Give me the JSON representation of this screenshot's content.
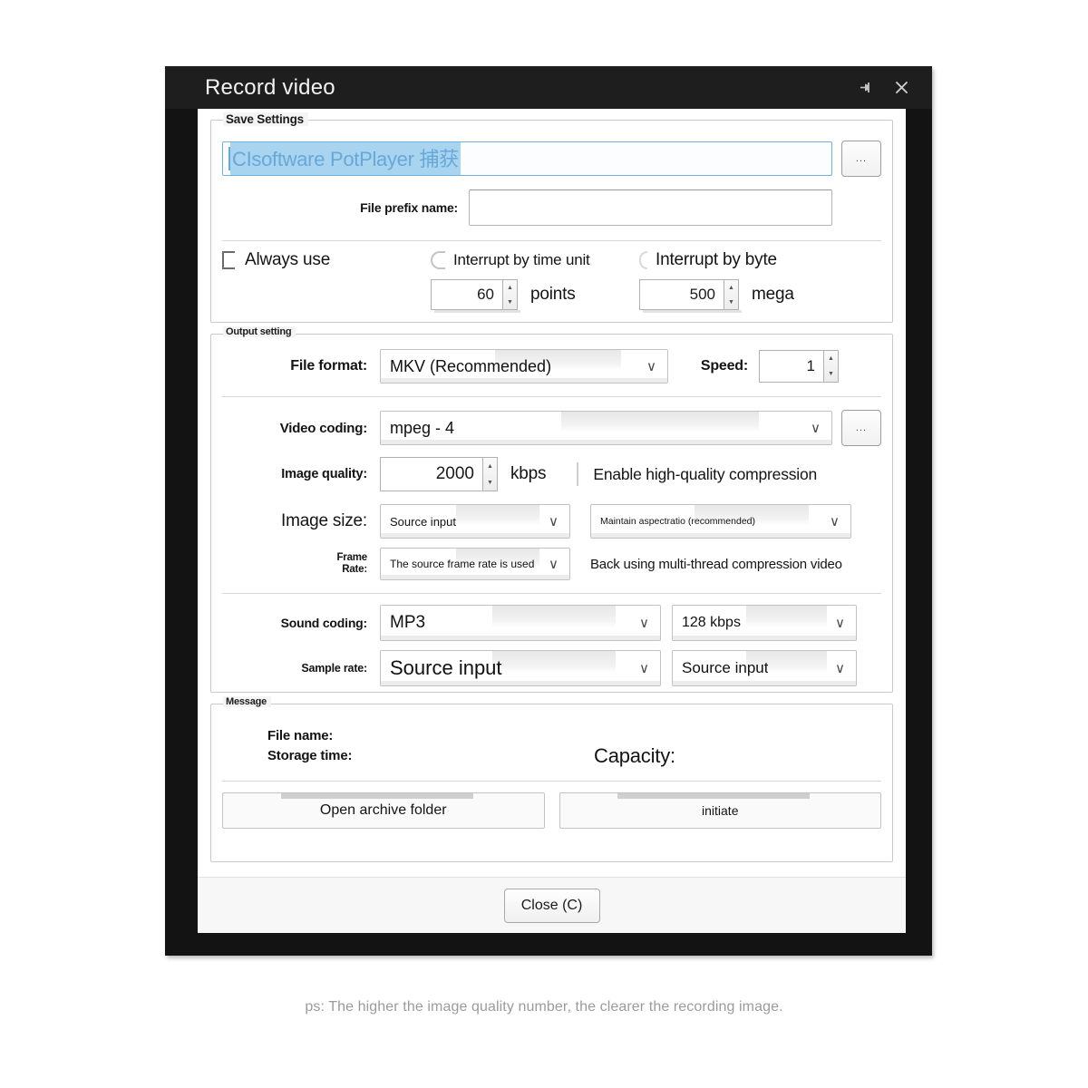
{
  "window": {
    "title": "Record video",
    "pin_icon": "pin-icon",
    "close_icon": "close-icon"
  },
  "save_settings": {
    "group_title": "Save Settings",
    "path_value": "CIsoftware PotPlayer 捕获",
    "path_browse_label": "...",
    "file_prefix_label": "File prefix name:",
    "file_prefix_value": "",
    "always_use_label": "Always use",
    "interrupt_time_label": "Interrupt by time unit",
    "interrupt_byte_label": "Interrupt by byte",
    "time_value": "60",
    "time_unit": "points",
    "byte_value": "500",
    "byte_unit": "mega"
  },
  "output_setting": {
    "group_title": "Output setting",
    "file_format_label": "File format:",
    "file_format_value": "MKV (Recommended)",
    "speed_label": "Speed:",
    "speed_value": "1",
    "video_coding_label": "Video coding:",
    "video_coding_value": "mpeg - 4",
    "video_coding_browse_label": "...",
    "image_quality_label": "Image quality:",
    "image_quality_value": "2000",
    "image_quality_unit": "kbps",
    "high_quality_label": "Enable high-quality compression",
    "image_size_label": "Image size:",
    "image_size_value": "Source input",
    "aspect_ratio_value": "Maintain aspectratio (recommended)",
    "frame_rate_label": "Frame\nRate:",
    "frame_rate_label_line1": "Frame",
    "frame_rate_label_line2": "Rate:",
    "frame_rate_value": "The source frame rate is used",
    "multithread_label": "Back using multi-thread compression video",
    "sound_coding_label": "Sound coding:",
    "sound_coding_value": "MP3",
    "sound_bitrate_value": "128 kbps",
    "sample_rate_label": "Sample rate:",
    "sample_rate_value": "Source input",
    "channel_value": "Source input"
  },
  "message": {
    "group_title": "Message",
    "file_name_label": "File name:",
    "storage_time_label": "Storage time:",
    "capacity_label": "Capacity:",
    "open_folder_label": "Open archive folder",
    "initiate_label": "initiate"
  },
  "footer": {
    "close_label": "Close (C)"
  },
  "footnote": {
    "text": "ps: The higher the image quality number, the clearer the recording image."
  },
  "colors": {
    "titlebar_bg": "#1e1e1e",
    "frame_bg": "#131313",
    "selection_bg": "#a8d4f0",
    "selection_fg": "#67a8d8",
    "footnote_fg": "#9b9b9b"
  }
}
